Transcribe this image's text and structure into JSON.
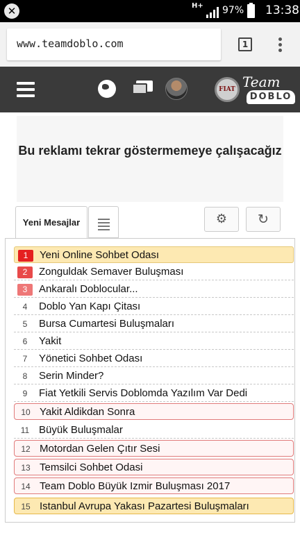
{
  "status_bar": {
    "network": "H+",
    "battery_percent": "97%",
    "time": "13:38"
  },
  "browser": {
    "url": "www.teamdoblo.com",
    "tab_count": "1"
  },
  "site_header": {
    "logo_brand": "FIAT",
    "logo_team": "Team",
    "logo_doblo": "DOBLO"
  },
  "ad": {
    "message": "Bu reklamı tekrar göstermemeye çalışacağız"
  },
  "tabs": {
    "new_messages_label": "Yeni Mesajlar"
  },
  "topics": [
    {
      "num": "1",
      "title": "Yeni Online Sohbet Odası",
      "style": "hot1"
    },
    {
      "num": "2",
      "title": "Zonguldak Semaver Buluşması",
      "style": "hot2"
    },
    {
      "num": "3",
      "title": "Ankaralı Doblocular...",
      "style": "hot3"
    },
    {
      "num": "4",
      "title": "Doblo Yan Kapı Çitası",
      "style": "plain"
    },
    {
      "num": "5",
      "title": "Bursa Cumartesi Buluşmaları",
      "style": "plain"
    },
    {
      "num": "6",
      "title": "Yakit",
      "style": "plain"
    },
    {
      "num": "7",
      "title": "Yönetici Sohbet Odası",
      "style": "plain"
    },
    {
      "num": "8",
      "title": "Serin Minder?",
      "style": "plain"
    },
    {
      "num": "9",
      "title": "Fiat Yetkili Servis Doblomda Yazılım Var Dedi",
      "style": "plain"
    },
    {
      "num": "10",
      "title": "Yakit Aldikdan Sonra",
      "style": "pink"
    },
    {
      "num": "11",
      "title": "Büyük Buluşmalar",
      "style": "plain"
    },
    {
      "num": "12",
      "title": "Motordan Gelen Çıtır Sesi",
      "style": "pink"
    },
    {
      "num": "13",
      "title": "Temsilci Sohbet Odasi",
      "style": "pink"
    },
    {
      "num": "14",
      "title": "Team Doblo Büyük Izmir Buluşması 2017",
      "style": "pink"
    },
    {
      "num": "15",
      "title": "Istanbul Avrupa Yakası Pazartesi Buluşmaları",
      "style": "yellow"
    }
  ]
}
